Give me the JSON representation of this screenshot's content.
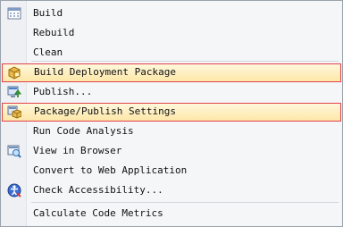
{
  "menu": {
    "items": [
      {
        "label": "Build",
        "icon": "build-icon"
      },
      {
        "label": "Rebuild"
      },
      {
        "label": "Clean"
      },
      {
        "label": "Build Deployment Package",
        "icon": "package-icon"
      },
      {
        "label": "Publish...",
        "icon": "publish-icon"
      },
      {
        "label": "Package/Publish Settings",
        "icon": "settings-icon"
      },
      {
        "label": "Run Code Analysis"
      },
      {
        "label": "View in Browser",
        "icon": "browser-icon"
      },
      {
        "label": "Convert to Web Application"
      },
      {
        "label": "Check Accessibility...",
        "icon": "accessibility-icon"
      },
      {
        "label": "Calculate Code Metrics"
      }
    ],
    "highlight_color": "#e3424b"
  }
}
